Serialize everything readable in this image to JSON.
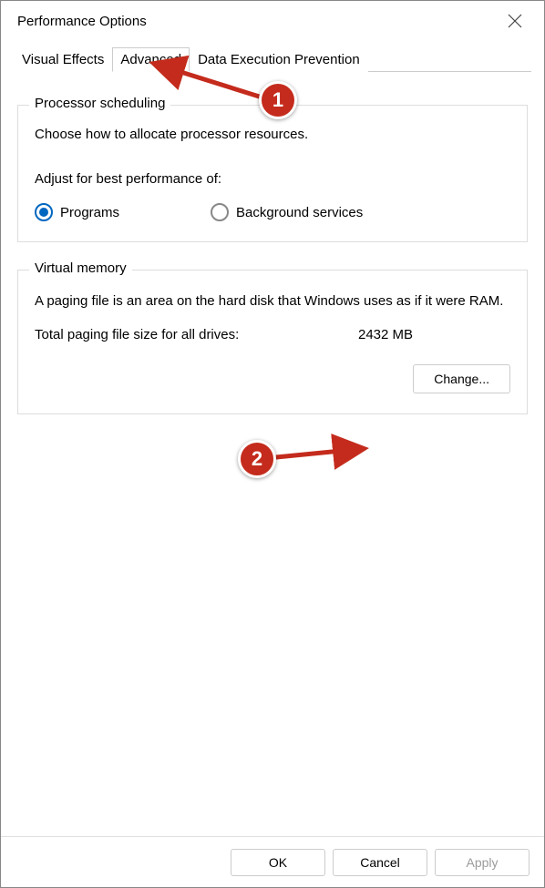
{
  "window": {
    "title": "Performance Options"
  },
  "tabs": {
    "visual_effects": "Visual Effects",
    "advanced": "Advanced",
    "dep": "Data Execution Prevention"
  },
  "processor": {
    "group_title": "Processor scheduling",
    "desc": "Choose how to allocate processor resources.",
    "adjust_label": "Adjust for best performance of:",
    "option_programs": "Programs",
    "option_background": "Background services"
  },
  "virtual_memory": {
    "group_title": "Virtual memory",
    "desc": "A paging file is an area on the hard disk that Windows uses as if it were RAM.",
    "total_label": "Total paging file size for all drives:",
    "total_value": "2432 MB",
    "change_btn": "Change..."
  },
  "buttons": {
    "ok": "OK",
    "cancel": "Cancel",
    "apply": "Apply"
  },
  "annotations": {
    "one": "1",
    "two": "2"
  }
}
